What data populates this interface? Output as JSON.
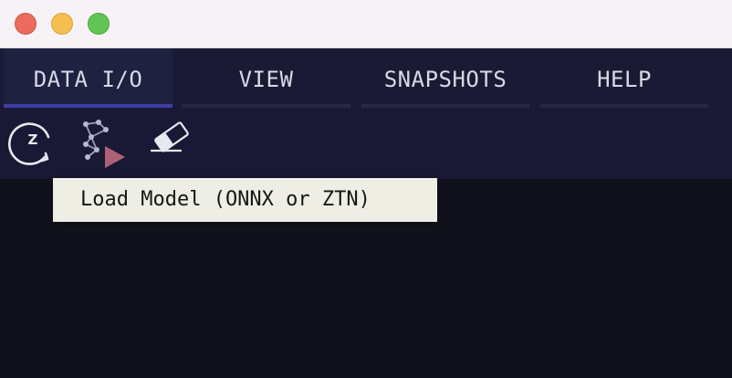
{
  "window": {
    "controls": [
      "close",
      "minimize",
      "maximize"
    ]
  },
  "menu": {
    "tabs": [
      {
        "label": "DATA I/O",
        "active": true
      },
      {
        "label": "VIEW",
        "active": false
      },
      {
        "label": "SNAPSHOTS",
        "active": false
      },
      {
        "label": "HELP",
        "active": false
      }
    ]
  },
  "toolbar": {
    "icons": [
      "reset-z-icon",
      "load-model-icon",
      "eraser-icon"
    ],
    "reset_glyph": "Z"
  },
  "tooltip": {
    "text": "Load Model (ONNX or ZTN)"
  },
  "colors": {
    "accent": "#3c3fa6",
    "menu_bg": "#1a1a34",
    "content_bg": "#11111b",
    "tooltip_bg": "#eeeee4",
    "play": "#e07a8c"
  }
}
